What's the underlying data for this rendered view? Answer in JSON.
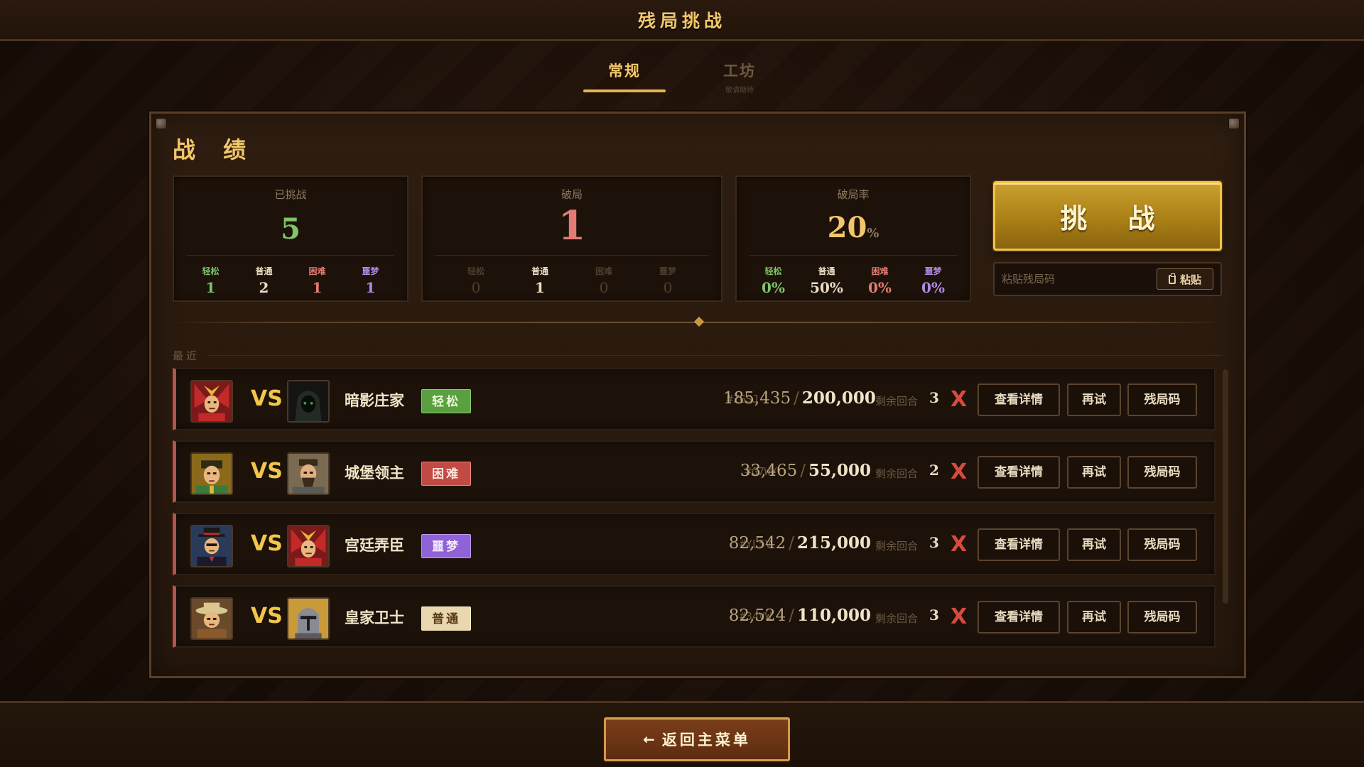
{
  "header": {
    "title": "残局挑战"
  },
  "tabs": [
    {
      "label": "常规",
      "active": true
    },
    {
      "label": "工坊",
      "sublabel": "敬请期待",
      "active": false
    }
  ],
  "record": {
    "title": "战 绩",
    "challenged": {
      "label": "已挑战",
      "value": "5",
      "easy_label": "轻松",
      "easy": "1",
      "normal_label": "普通",
      "normal": "2",
      "hard_label": "困难",
      "hard": "1",
      "night_label": "噩梦",
      "night": "1"
    },
    "broken": {
      "label": "破局",
      "value": "1",
      "easy_label": "轻松",
      "easy": "0",
      "normal_label": "普通",
      "normal": "1",
      "hard_label": "困难",
      "hard": "0",
      "night_label": "噩梦",
      "night": "0"
    },
    "rate": {
      "label": "破局率",
      "value": "20",
      "unit": "%",
      "easy_label": "轻松",
      "easy": "0%",
      "normal_label": "普通",
      "normal": "50%",
      "hard_label": "困难",
      "hard": "0%",
      "night_label": "噩梦",
      "night": "0%"
    }
  },
  "challenge_button": "挑 战",
  "paste": {
    "placeholder": "粘贴残局码",
    "button": "粘贴",
    "icon": "clipboard-icon"
  },
  "recent_label": "最近",
  "recent": [
    {
      "opponent": "暗影庄家",
      "difficulty": "轻松",
      "code": "#ZGSJ",
      "score": "185,435",
      "target": "200,000",
      "turns_label": "剩余回合",
      "turns": "3",
      "result": "X"
    },
    {
      "opponent": "城堡领主",
      "difficulty": "困难",
      "code": "#G7WY",
      "score": "33,465",
      "target": "55,000",
      "turns_label": "剩余回合",
      "turns": "2",
      "result": "X"
    },
    {
      "opponent": "宫廷弄臣",
      "difficulty": "噩梦",
      "code": "#YL5V",
      "score": "82,542",
      "target": "215,000",
      "turns_label": "剩余回合",
      "turns": "3",
      "result": "X"
    },
    {
      "opponent": "皇家卫士",
      "difficulty": "普通",
      "code": "#34VW",
      "score": "82,524",
      "target": "110,000",
      "turns_label": "剩余回合",
      "turns": "3",
      "result": "X"
    }
  ],
  "row_actions": {
    "details": "查看详情",
    "retry": "再试",
    "code": "残局码"
  },
  "back_button": {
    "arrow": "←",
    "label": "返回主菜单"
  },
  "colors": {
    "gold": "#f2c66a",
    "easy": "#5aa040",
    "hard": "#c24a44",
    "nightmare": "#8f62d8",
    "normal": "#e9d7ad",
    "fail": "#d84a3e"
  }
}
